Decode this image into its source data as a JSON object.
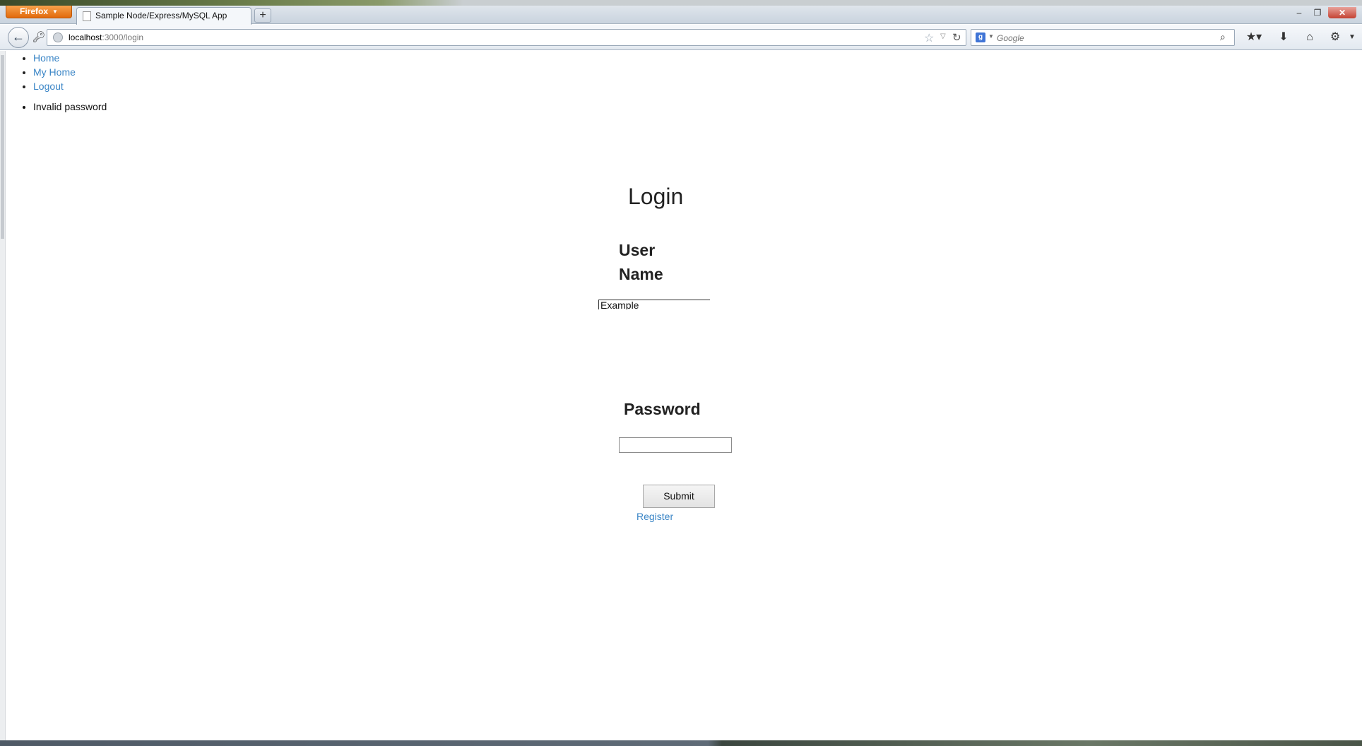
{
  "browser": {
    "app_button_label": "Firefox",
    "tab_title": "Sample Node/Express/MySQL App",
    "new_tab_label": "+",
    "url_host": "localhost",
    "url_path": ":3000/login",
    "search_placeholder": "Google",
    "search_engine_letter": "g",
    "window_controls": {
      "minimize": "–",
      "restore": "❐",
      "close": "✕"
    }
  },
  "nav": {
    "items": [
      {
        "label": "Home"
      },
      {
        "label": "My Home"
      },
      {
        "label": "Logout"
      }
    ]
  },
  "messages": {
    "errors": [
      "Invalid password"
    ]
  },
  "login": {
    "title": "Login",
    "username_label": "User Name",
    "username_value": "Example",
    "password_label": "Password",
    "password_value": "",
    "submit_label": "Submit",
    "register_label": "Register"
  },
  "icons": {
    "back": "back-arrow-icon",
    "key": "key-icon",
    "star": "bookmark-star-icon",
    "reload": "reload-icon",
    "search": "magnifier-icon",
    "bookmarks": "bookmarks-icon",
    "download": "download-icon",
    "home": "home-icon",
    "addon": "addon-icon"
  },
  "colors": {
    "link": "#3a85c6",
    "firefox_button": "#e26a0c",
    "close_button": "#c44232"
  }
}
